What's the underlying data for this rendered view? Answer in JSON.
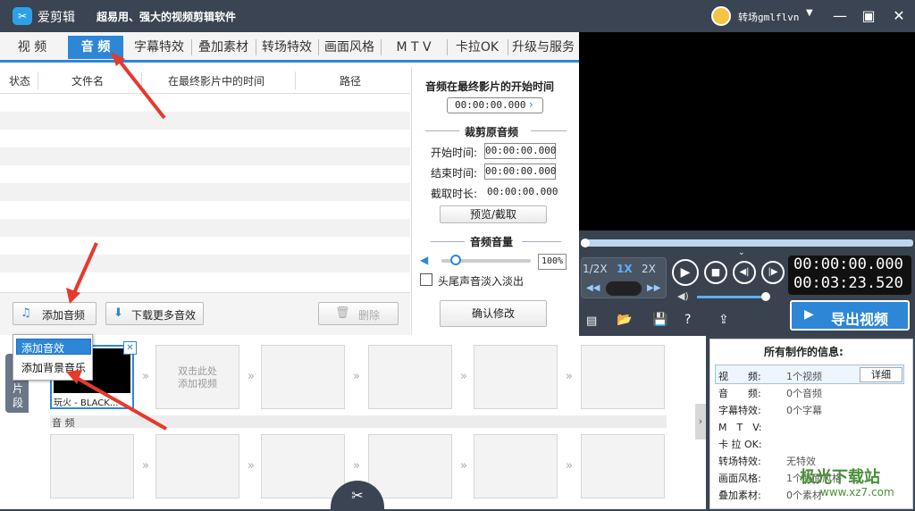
{
  "titlebar": {
    "app_name": "爱剪辑",
    "slogan": "超易用、强大的视频剪辑软件",
    "username": "转场gmlflvn"
  },
  "tabs": [
    "视 频",
    "音 频",
    "字幕特效",
    "叠加素材",
    "转场特效",
    "画面风格",
    "M T V",
    "卡拉OK",
    "升级与服务"
  ],
  "table": {
    "headers": [
      "状态",
      "文件名",
      "在最终影片中的时间",
      "路径"
    ]
  },
  "settings": {
    "start_in_movie_label": "音频在最终影片的开始时间",
    "start_in_movie_value": "00:00:00.000",
    "trim_title": "裁剪原音频",
    "start_label": "开始时间:",
    "start_value": "00:00:00.000",
    "end_label": "结束时间:",
    "end_value": "00:00:00.000",
    "duration_label": "截取时长:",
    "duration_value": "00:00:00.000",
    "preview_button": "预览/截取",
    "volume_title": "音频音量",
    "volume_value": "100%",
    "fade_label": "头尾声音淡入淡出",
    "confirm_button": "确认修改"
  },
  "bottombar": {
    "add_audio": "添加音频",
    "download_effects": "下载更多音效",
    "delete": "删除"
  },
  "dropdown": [
    "添加音效",
    "添加背景音乐"
  ],
  "player": {
    "speeds": [
      "1/2X",
      "1X",
      "2X"
    ],
    "current_time": "00:00:00.000",
    "total_time": "00:03:23.520",
    "export": "导出视频"
  },
  "timeline": {
    "side_label_1": "片",
    "side_label_2": "段",
    "clip_name": "玩火 - BLACK...",
    "dblclick_hint_1": "双击此处",
    "dblclick_hint_2": "添加视频",
    "audio_label": "音 频"
  },
  "info": {
    "title": "所有制作的信息:",
    "detail_button": "详细",
    "rows": [
      {
        "label": "视　　频:",
        "value": "1个视频"
      },
      {
        "label": "音　　频:",
        "value": "0个音频"
      },
      {
        "label": "字幕特效:",
        "value": "0个字幕"
      },
      {
        "label": "M　T　V:",
        "value": ""
      },
      {
        "label": "卡 拉 OK:",
        "value": ""
      },
      {
        "label": "转场特效:",
        "value": "无特效"
      },
      {
        "label": "画面风格:",
        "value": "1个画面风格"
      },
      {
        "label": "叠加素材:",
        "value": "0个素材"
      }
    ]
  },
  "watermark": "极光下载站",
  "watermark_url": "www.xz7.com",
  "colors": {
    "accent": "#2e86d6",
    "titlebar": "#3a4452",
    "annotation": "#e53a2c"
  }
}
